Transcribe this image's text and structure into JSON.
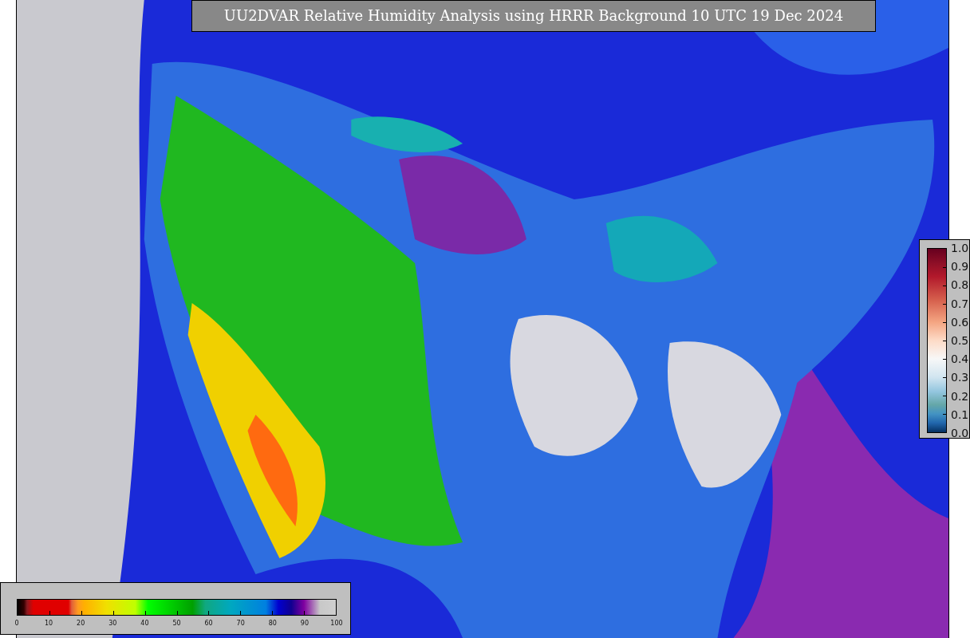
{
  "title": "UU2DVAR Relative Humidity Analysis using HRRR Background 10 UTC 19 Dec 2024",
  "colorbars": [
    {
      "kind": "vertical",
      "ticks": [
        "1.0",
        "0.9",
        "0.8",
        "0.7",
        "0.6",
        "0.5",
        "0.4",
        "0.3",
        "0.2",
        "0.1",
        "0.0"
      ]
    },
    {
      "kind": "horizontal",
      "ticks": [
        "0",
        "10",
        "20",
        "30",
        "40",
        "50",
        "60",
        "70",
        "80",
        "90",
        "100"
      ]
    }
  ]
}
